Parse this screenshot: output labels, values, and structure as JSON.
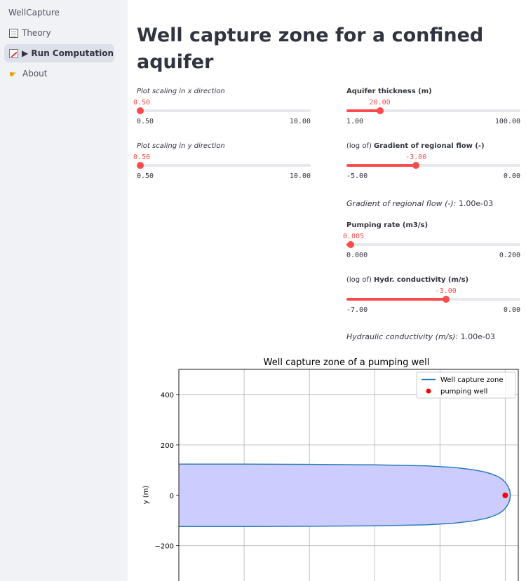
{
  "sidebar": {
    "app_name": "WellCapture",
    "items": [
      {
        "label": "Theory",
        "icon": "document-icon"
      },
      {
        "label": "▶ Run Computation",
        "icon": "chart-icon"
      },
      {
        "label": "About",
        "icon": "pointing-hand-icon"
      }
    ]
  },
  "main": {
    "title": "Well capture zone for a confined aquifer",
    "sliders": {
      "x_scaling": {
        "label": "Plot scaling in x direction",
        "value": 0.5,
        "value_text": "0.50",
        "min": 0.5,
        "max": 10,
        "min_text": "0.50",
        "max_text": "10.00"
      },
      "y_scaling": {
        "label": "Plot scaling in y direction",
        "value": 0.5,
        "value_text": "0.50",
        "min": 0.5,
        "max": 10,
        "min_text": "0.50",
        "max_text": "10.00"
      },
      "thickness": {
        "label": "Aquifer thickness (m)",
        "value": 20,
        "value_text": "20.00",
        "min": 1,
        "max": 100,
        "min_text": "1.00",
        "max_text": "100.00"
      },
      "gradient": {
        "label_prefix": "(log of) ",
        "label_bold": "Gradient of regional flow (-)",
        "value": -3,
        "value_text": "-3.00",
        "min": -5,
        "max": 0,
        "min_text": "-5.00",
        "max_text": "0.00"
      },
      "pumping": {
        "label": "Pumping rate (m3/s)",
        "value": 0.005,
        "value_text": "0.005",
        "min": 0,
        "max": 0.2,
        "min_text": "0.000",
        "max_text": "0.200"
      },
      "conductivity": {
        "label_prefix": "(log of) ",
        "label_bold": "Hydr. conductivity (m/s)",
        "value": -3,
        "value_text": "-3.00",
        "min": -7,
        "max": 0,
        "min_text": "-7.00",
        "max_text": "0.00"
      }
    },
    "gradient_info": {
      "label": "Gradient of regional flow (-):",
      "value": " 1.00e-03"
    },
    "conductivity_info": {
      "label": "Hydraulic conductivity (m/s):",
      "value": " 1.00e-03"
    }
  },
  "chart_data": {
    "type": "area",
    "title": "Well capture zone of a pumping well",
    "xlabel": "",
    "ylabel": "y (m)",
    "ylim": [
      -340,
      500
    ],
    "xlim": [
      -2500,
      100
    ],
    "yticks": [
      400,
      200,
      0,
      -200
    ],
    "ytick_labels": [
      "400",
      "200",
      "0",
      "−200"
    ],
    "xgrid": [
      -2000,
      -1500,
      -1000,
      -500,
      0
    ],
    "grid": true,
    "legend_placement": "top-right",
    "series": [
      {
        "name": "Well capture zone",
        "color": "#1f77b4",
        "fill": "#ccccff",
        "x": [
          -2500,
          -2000,
          -1500,
          -1000,
          -600,
          -400,
          -250,
          -150,
          -100,
          -50,
          -20,
          0,
          20,
          35,
          39
        ],
        "y": [
          124,
          124,
          123,
          121,
          117,
          111,
          102,
          92,
          84,
          73,
          62,
          52,
          37,
          19,
          0
        ]
      },
      {
        "name": "pumping well",
        "color": "#ff0000",
        "marker": "circle",
        "x": [
          0
        ],
        "y": [
          0
        ]
      }
    ]
  }
}
